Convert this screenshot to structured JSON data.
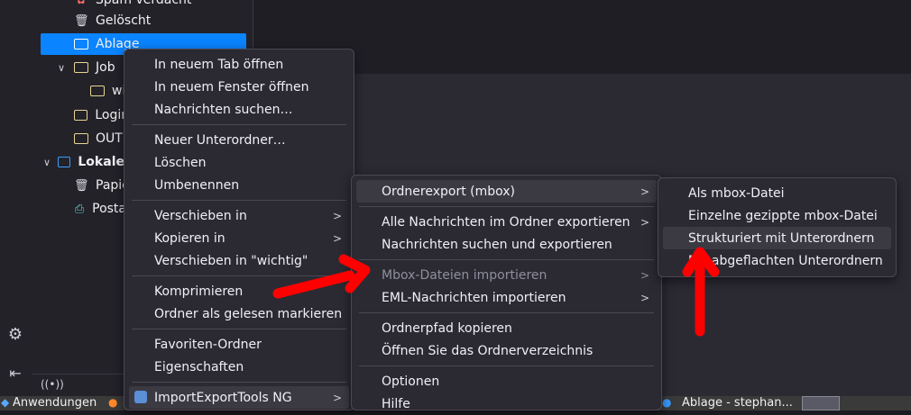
{
  "folder_tree": {
    "items": [
      {
        "label": "Spam verdacht",
        "icon": "spam-icon"
      },
      {
        "label": "Gelöscht",
        "icon": "trash-icon"
      },
      {
        "label": "Ablage",
        "icon": "folder-icon"
      },
      {
        "label": "Job",
        "icon": "folder-icon"
      },
      {
        "label": "wi",
        "icon": "folder-icon"
      },
      {
        "label": "Logir",
        "icon": "folder-icon"
      },
      {
        "label": "OUTI",
        "icon": "folder-icon"
      },
      {
        "label": "Lokale",
        "icon": "folder-icon"
      },
      {
        "label": "Papie",
        "icon": "trash-icon"
      },
      {
        "label": "Posta",
        "icon": "outbox-icon"
      }
    ]
  },
  "context_menu": {
    "items": [
      {
        "label": "In neuem Tab öffnen"
      },
      {
        "label": "In neuem Fenster öffnen"
      },
      {
        "label": "Nachrichten suchen…"
      },
      {
        "label": "Neuer Unterordner…"
      },
      {
        "label": "Löschen"
      },
      {
        "label": "Umbenennen"
      },
      {
        "label": "Verschieben in"
      },
      {
        "label": "Kopieren in"
      },
      {
        "label": "Verschieben in \"wichtig\""
      },
      {
        "label": "Komprimieren"
      },
      {
        "label": "Ordner als gelesen markieren"
      },
      {
        "label": "Favoriten-Ordner"
      },
      {
        "label": "Eigenschaften"
      },
      {
        "label": "ImportExportTools NG"
      }
    ]
  },
  "submenu": {
    "items": [
      {
        "label": "Ordnerexport (mbox)"
      },
      {
        "label": "Alle Nachrichten im Ordner exportieren"
      },
      {
        "label": "Nachrichten suchen und exportieren"
      },
      {
        "label": "Mbox-Dateien importieren"
      },
      {
        "label": "EML-Nachrichten importieren"
      },
      {
        "label": "Ordnerpfad kopieren"
      },
      {
        "label": "Öffnen Sie das Ordnerverzeichnis"
      },
      {
        "label": "Optionen"
      },
      {
        "label": "Hilfe"
      }
    ]
  },
  "submenu2": {
    "items": [
      {
        "label": "Als mbox-Datei"
      },
      {
        "label": "Einzelne gezippte mbox-Datei"
      },
      {
        "label": "Strukturiert mit Unterordnern"
      },
      {
        "label": "Mit abgeflachten Unterordnern"
      }
    ]
  },
  "taskbar": {
    "apps_label": "Anwendungen",
    "window_label": "Ablage - stephan..."
  },
  "colors": {
    "accent": "#0a84ff",
    "annotation": "#ff0000"
  }
}
